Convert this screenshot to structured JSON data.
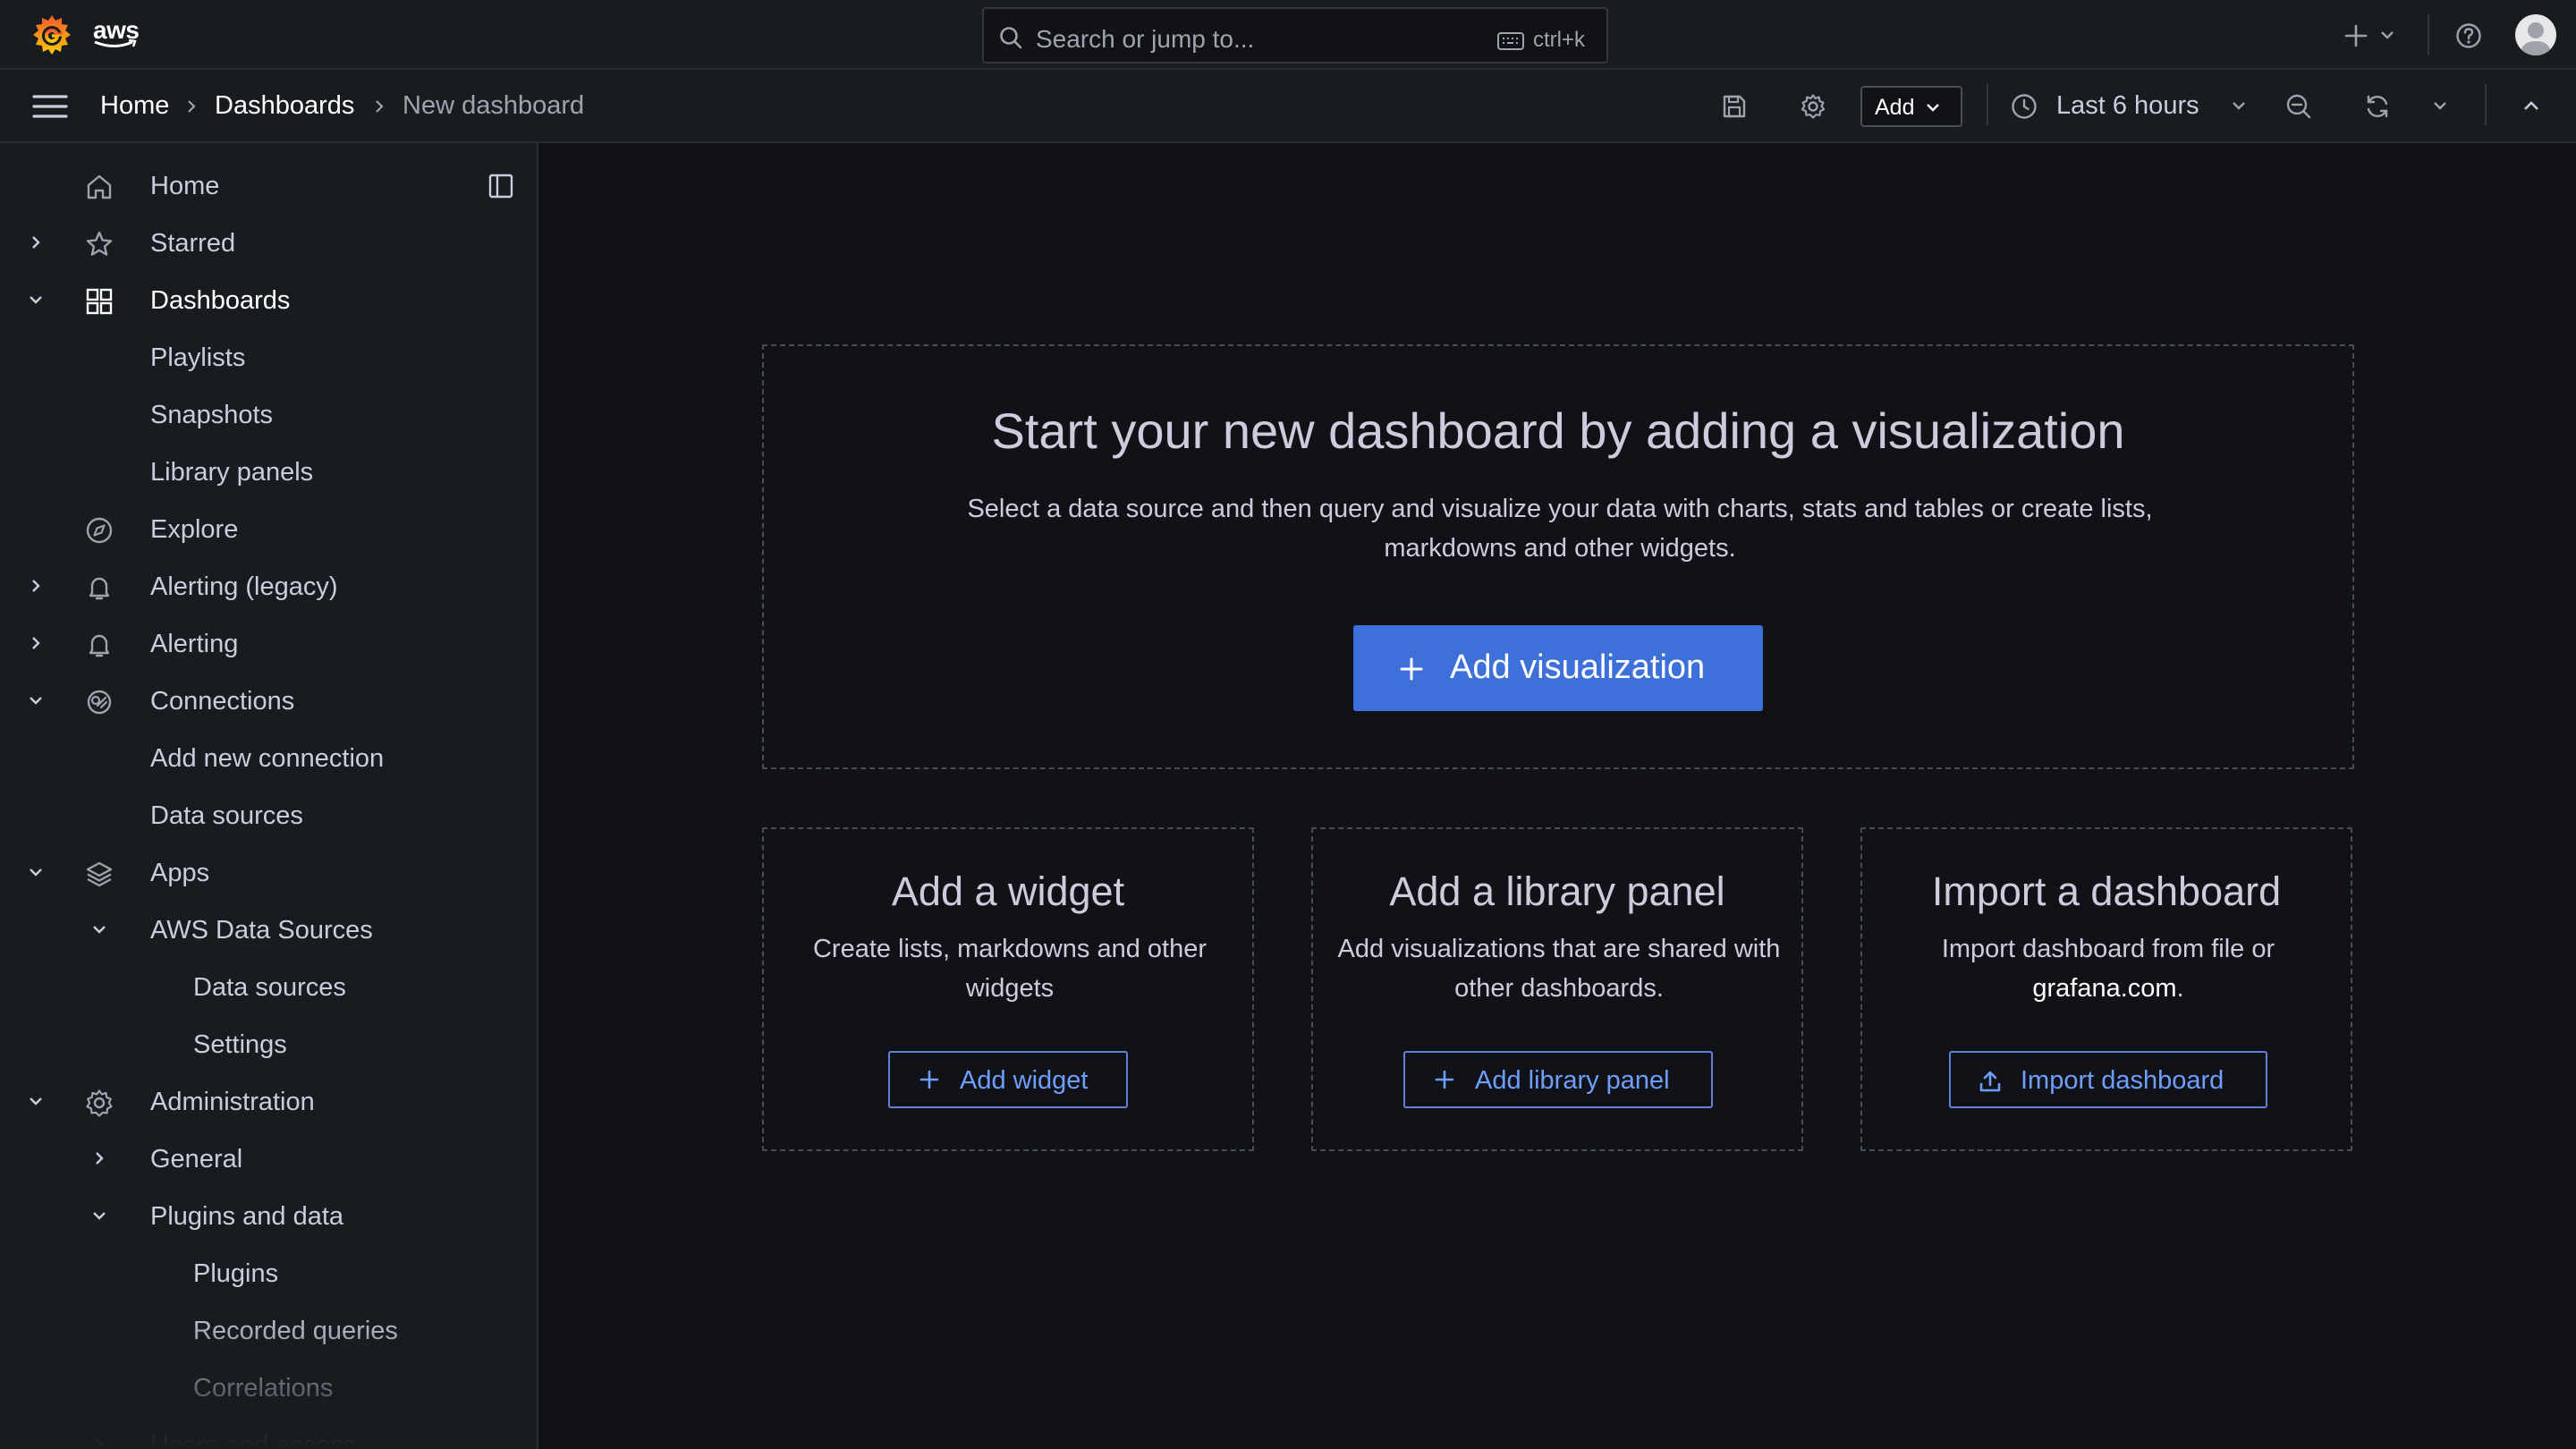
{
  "brand": {
    "aws_label": "aws"
  },
  "search": {
    "placeholder": "Search or jump to...",
    "shortcut": "ctrl+k"
  },
  "breadcrumb": {
    "home": "Home",
    "dashboards": "Dashboards",
    "current": "New dashboard"
  },
  "toolbar": {
    "add_label": "Add",
    "time_range": "Last 6 hours"
  },
  "sidebar": {
    "items": [
      {
        "label": "Home",
        "icon": "home-icon"
      },
      {
        "label": "Starred",
        "icon": "star-icon"
      },
      {
        "label": "Dashboards",
        "icon": "apps-icon"
      },
      {
        "label": "Playlists"
      },
      {
        "label": "Snapshots"
      },
      {
        "label": "Library panels"
      },
      {
        "label": "Explore",
        "icon": "compass-icon"
      },
      {
        "label": "Alerting (legacy)",
        "icon": "bell-icon"
      },
      {
        "label": "Alerting",
        "icon": "bell-icon"
      },
      {
        "label": "Connections",
        "icon": "connections-icon"
      },
      {
        "label": "Add new connection"
      },
      {
        "label": "Data sources"
      },
      {
        "label": "Apps",
        "icon": "layers-icon"
      },
      {
        "label": "AWS Data Sources"
      },
      {
        "label": "Data sources"
      },
      {
        "label": "Settings"
      },
      {
        "label": "Administration",
        "icon": "cog-icon"
      },
      {
        "label": "General"
      },
      {
        "label": "Plugins and data"
      },
      {
        "label": "Plugins"
      },
      {
        "label": "Recorded queries"
      },
      {
        "label": "Correlations"
      },
      {
        "label": "Users and access"
      }
    ]
  },
  "empty_state": {
    "title": "Start your new dashboard by adding a visualization",
    "description": "Select a data source and then query and visualize your data with charts, stats and tables or create lists, markdowns and other widgets.",
    "button": "Add visualization"
  },
  "cards": [
    {
      "title": "Add a widget",
      "description": "Create lists, markdowns and other widgets",
      "button": "Add widget"
    },
    {
      "title": "Add a library panel",
      "description": "Add visualizations that are shared with other dashboards.",
      "button": "Add library panel"
    },
    {
      "title": "Import a dashboard",
      "description_prefix": "Import dashboard from file or",
      "description_link": "grafana.com",
      "description_suffix": ".",
      "button": "Import dashboard"
    }
  ],
  "colors": {
    "accent": "#3d71d9",
    "background": "#111217",
    "panel": "#181b1f",
    "link": "#6e9fff"
  }
}
